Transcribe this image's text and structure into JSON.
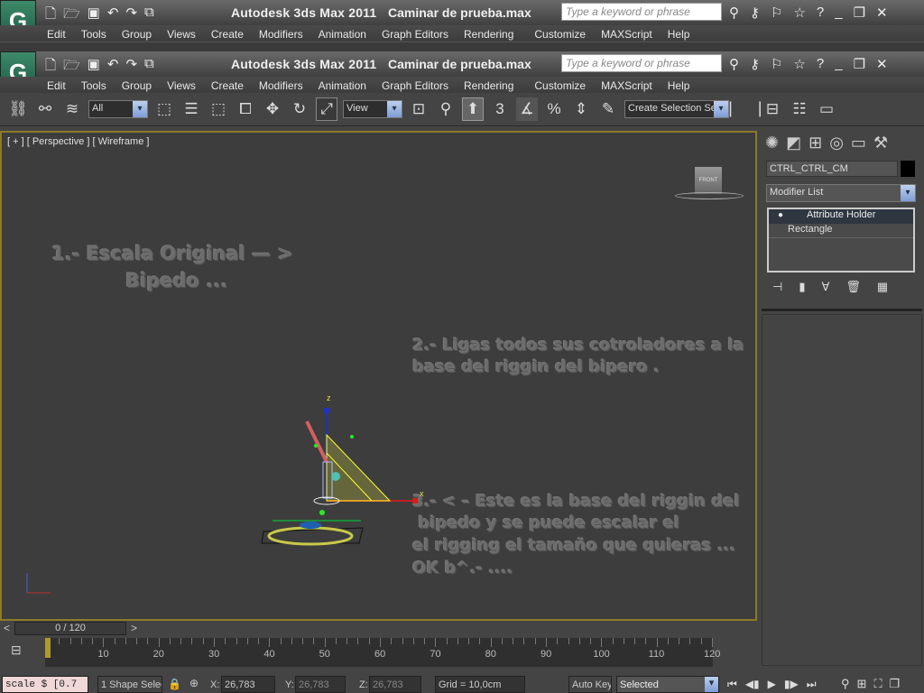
{
  "app": {
    "name": "Autodesk 3ds Max  2011",
    "document": "Caminar de prueba.max",
    "logo_text": "G"
  },
  "search": {
    "placeholder": "Type a keyword or phrase"
  },
  "menu": [
    "Edit",
    "Tools",
    "Group",
    "Views",
    "Create",
    "Modifiers",
    "Animation",
    "Graph Editors",
    "Rendering",
    "Customize",
    "MAXScript",
    "Help"
  ],
  "toolbar": {
    "selection_filter": "All",
    "reference_coord": "View",
    "named_selection": "Create Selection Se",
    "snap_value": "3"
  },
  "viewport": {
    "label_plus": "[ + ]",
    "label_view": "[ Perspective ]",
    "label_shading": "[ Wireframe ]",
    "viewcube_label": "FRONT",
    "notes": [
      "1.- Escala Original — >",
      "Bipedo ...",
      "2.- Ligas todos sus cotroladores a la",
      "base del riggin del bipero .",
      "3.- < – Este es la base del riggin del",
      " bipedo y se puede escalar el",
      "el rigging el tamaño que quieras ...",
      "OK b^.- ...."
    ],
    "axis_labels": {
      "z": "z",
      "x": "x"
    }
  },
  "command_panel": {
    "object_name": "CTRL_CTRL_CM",
    "modifier_list": "Modifier List",
    "stack": [
      "Attribute Holder",
      "Rectangle"
    ],
    "object_color": "#000000"
  },
  "timeline": {
    "frame_display": "0 / 120",
    "current_frame": 0,
    "ticks": [
      "0",
      "10",
      "20",
      "30",
      "40",
      "50",
      "60",
      "70",
      "80",
      "90",
      "100",
      "110",
      "120"
    ]
  },
  "status": {
    "maxscript": "scale $ [0.7",
    "selection": "1 Shape Selec",
    "x_label": "X:",
    "x": "26,783",
    "y_label": "Y:",
    "y": "26,783",
    "z_label": "Z:",
    "z": "26,783",
    "grid": "Grid = 10,0cm",
    "auto_key": "Auto Key",
    "key_filter": "Selected"
  },
  "colors": {
    "viewport_border": "#8c7a2a",
    "logo": "#2d7a5a"
  }
}
